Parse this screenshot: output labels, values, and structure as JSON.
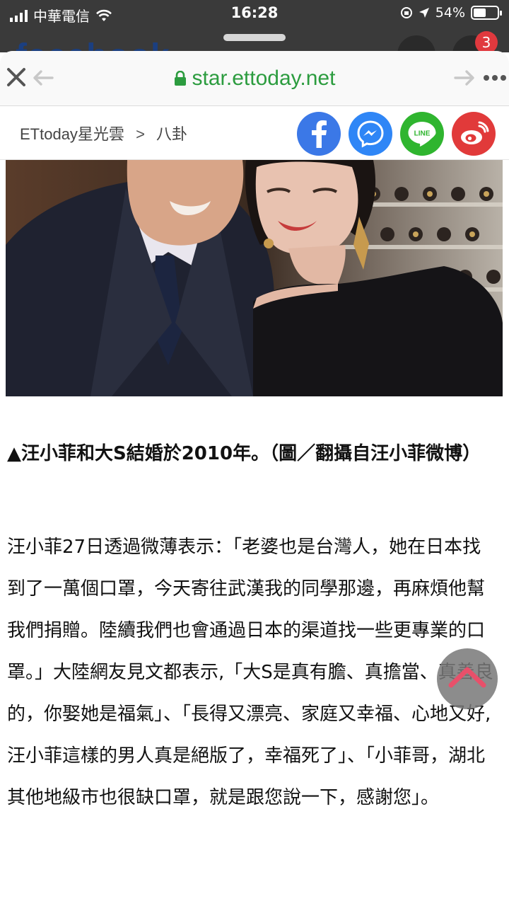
{
  "status_bar": {
    "carrier": "中華電信",
    "time": "16:28",
    "battery_percent": "54%",
    "battery_level": 0.54
  },
  "background_page": {
    "logo_text": "facebook",
    "notification_count": "3"
  },
  "browser": {
    "url": "star.ettoday.net",
    "close_icon": "close-icon",
    "back_icon": "back-arrow-icon",
    "forward_icon": "forward-arrow-icon",
    "more_icon": "more-icon"
  },
  "breadcrumb": {
    "home": "ETtoday星光雲",
    "separator": ">",
    "section": "八卦"
  },
  "share": {
    "line_label": "LINE",
    "icons": [
      "facebook-icon",
      "messenger-icon",
      "line-icon",
      "weibo-icon"
    ],
    "colors": {
      "facebook": "#3b78e7",
      "messenger": "#2f86f6",
      "line": "#2fb52f",
      "weibo": "#e13a3a"
    }
  },
  "article": {
    "caption": "▲汪小菲和大S結婚於2010年。（圖／翻攝自汪小菲微博）",
    "body": "汪小菲27日透過微薄表示：「老婆也是台灣人，她在日本找到了一萬個口罩，今天寄往武漢我的同學那邊，再麻煩他幫我們捐贈。陸續我們也會通過日本的渠道找一些更專業的口罩。」大陸網友見文都表示,「大S是真有膽、真擔當、真善良的，你娶她是福氣」、「長得又漂亮、家庭又幸福、心地又好,汪小菲這樣的男人真是絕版了，幸福死了」、「小菲哥，湖北其他地級市也很缺口罩，就是跟您說一下，感謝您」。"
  },
  "colors": {
    "url_green": "#2c9c3f",
    "to_top_arrow": "#e8506a"
  }
}
